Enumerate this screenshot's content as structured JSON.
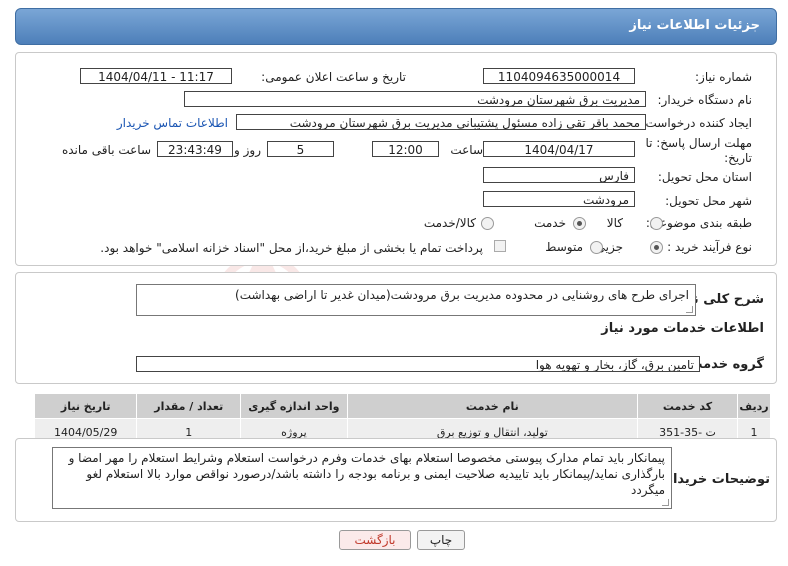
{
  "header": {
    "title": "جزئیات اطلاعات نیاز"
  },
  "form": {
    "need_number_label": "شماره نیاز:",
    "need_number": "1104094635000014",
    "announce_label": "تاریخ و ساعت اعلان عمومی:",
    "announce_value": "1404/04/11 - 11:17",
    "buyer_org_label": "نام دستگاه خریدار:",
    "buyer_org": "مدیریت برق شهرستان مرودشت",
    "requester_label": "ایجاد کننده درخواست:",
    "requester": "محمد باقر  تقی زاده مسئول پشتیبانی مدیریت برق شهرستان مرودشت",
    "contact_link": "اطلاعات تماس خریدار",
    "deadline_label_1": "مهلت ارسال پاسخ: تا",
    "deadline_label_2": "تاریخ:",
    "deadline_date": "1404/04/17",
    "time_label": "ساعت",
    "deadline_time": "12:00",
    "days_value": "5",
    "days_label": "روز و",
    "remaining_time": "23:43:49",
    "remaining_label": "ساعت باقی مانده",
    "province_label": "استان محل تحویل:",
    "province": "فارس",
    "city_label": "شهر محل تحویل:",
    "city": "مرودشت",
    "category_label": "طبقه بندی موضوعی:",
    "category_options": [
      "کالا",
      "خدمت",
      "کالا/خدمت"
    ],
    "category_selected": 1,
    "process_label": "نوع فرآیند خرید :",
    "process_options": [
      "جزیی",
      "متوسط"
    ],
    "process_selected": 0,
    "payment_note": "پرداخت تمام یا بخشی از مبلغ خرید،از محل \"اسناد خزانه اسلامی\" خواهد بود."
  },
  "description": {
    "label": "شرح کلی نیاز:",
    "value": "اجرای طرح های روشنایی در محدوده مدیریت برق مرودشت(میدان غدیر تا اراضی بهداشت)"
  },
  "services": {
    "section_title": "اطلاعات خدمات مورد نیاز",
    "group_label": "گروه خدمت:",
    "group_value": "تامین برق، گاز، بخار و تهویه هوا",
    "columns": [
      "ردیف",
      "کد خدمت",
      "نام خدمت",
      "واحد اندازه گیری",
      "تعداد / مقدار",
      "تاریخ نیاز"
    ],
    "rows": [
      [
        "1",
        "ت -35-351",
        "تولید، انتقال و توزیع برق",
        "پروژه",
        "1",
        "1404/05/29"
      ]
    ]
  },
  "buyer_notes": {
    "label": "توضیحات خریدار:",
    "value": "پیمانکار باید تمام مدارک پیوستی مخصوصا استعلام بهای خدمات وفرم درخواست استعلام وشرایط استعلام را مهر امضا و بارگذاری نماید/پیمانکار باید تاییدیه صلاحیت ایمنی و برنامه بودجه را داشته باشد/درصورد نواقص موارد بالا استعلام لغو میگردد"
  },
  "buttons": {
    "print": "چاپ",
    "back": "بازگشت"
  },
  "watermark": {
    "text": "AriaTender.neT",
    "color": "#d9534f"
  },
  "colors": {
    "title_bar": "#5a8bc4",
    "link": "#1a55b3"
  }
}
